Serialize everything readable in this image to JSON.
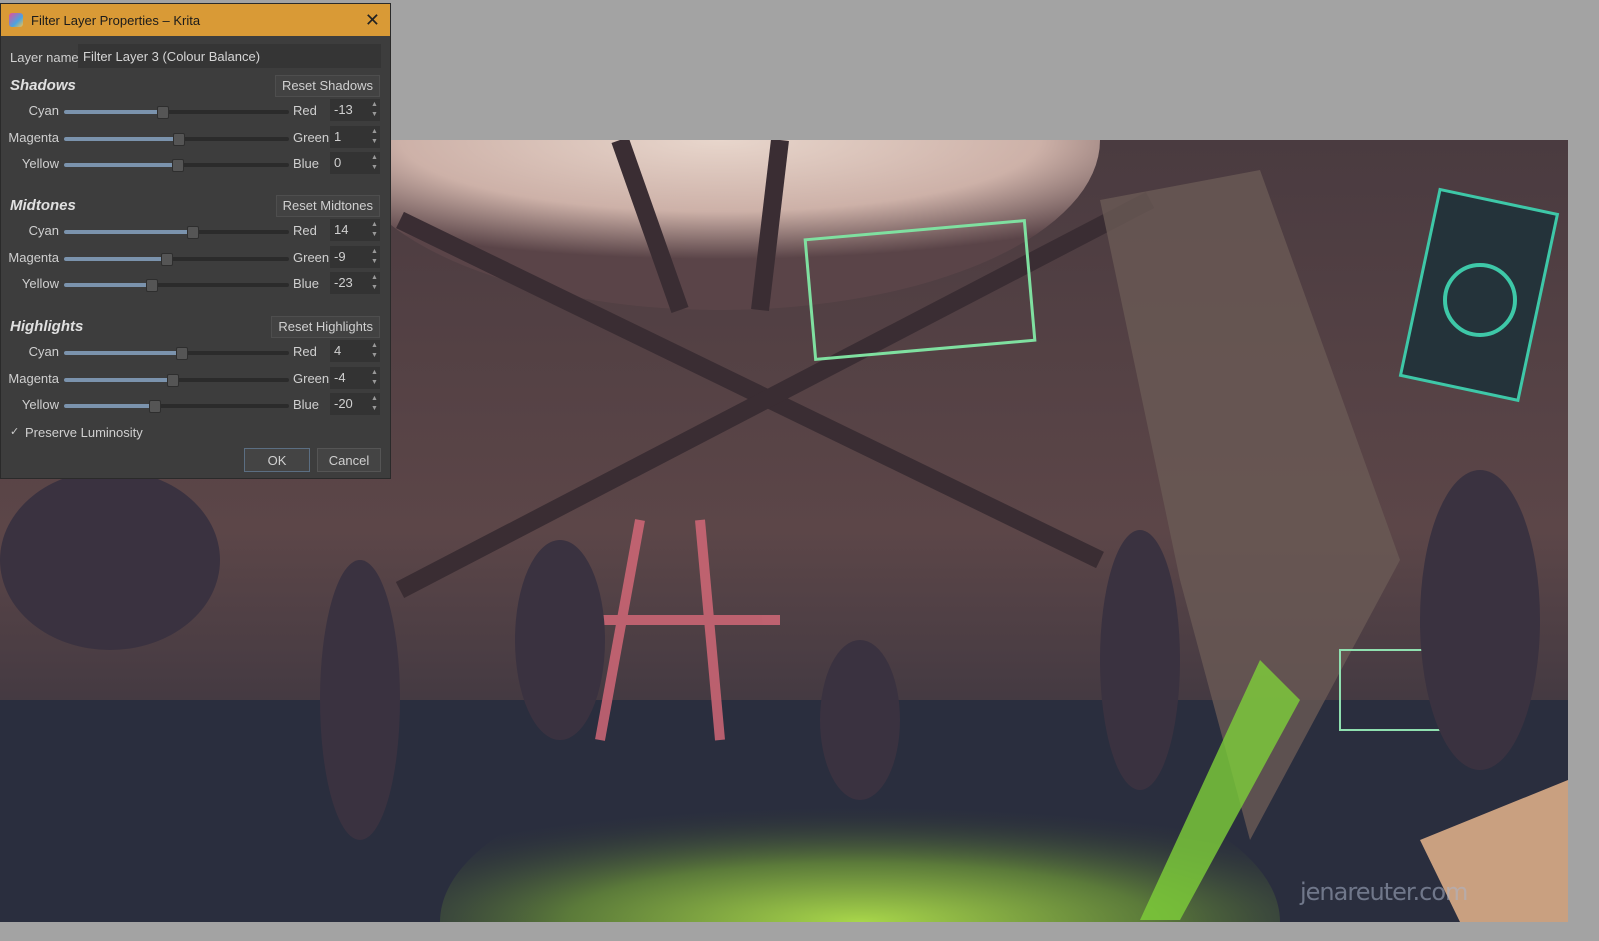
{
  "window": {
    "title": "Filter Layer Properties – Krita",
    "close_icon": "close-icon"
  },
  "layer_name": {
    "label": "Layer name:",
    "value": "Filter Layer 3 (Colour Balance)"
  },
  "sections": [
    {
      "title": "Shadows",
      "reset_label": "Reset Shadows",
      "rows": [
        {
          "left": "Cyan",
          "right": "Red",
          "value": -13
        },
        {
          "left": "Magenta",
          "right": "Green",
          "value": 1
        },
        {
          "left": "Yellow",
          "right": "Blue",
          "value": 0
        }
      ]
    },
    {
      "title": "Midtones",
      "reset_label": "Reset Midtones",
      "rows": [
        {
          "left": "Cyan",
          "right": "Red",
          "value": 14
        },
        {
          "left": "Magenta",
          "right": "Green",
          "value": -9
        },
        {
          "left": "Yellow",
          "right": "Blue",
          "value": -23
        }
      ]
    },
    {
      "title": "Highlights",
      "reset_label": "Reset Highlights",
      "rows": [
        {
          "left": "Cyan",
          "right": "Red",
          "value": 4
        },
        {
          "left": "Magenta",
          "right": "Green",
          "value": -4
        },
        {
          "left": "Yellow",
          "right": "Blue",
          "value": -20
        }
      ]
    }
  ],
  "slider_range": [
    -100,
    100
  ],
  "preserve_luminosity": {
    "label": "Preserve Luminosity",
    "checked": true
  },
  "buttons": {
    "ok": "OK",
    "cancel": "Cancel"
  },
  "artwork": {
    "watermark": "jenareuter.com"
  },
  "colors": {
    "titlebar": "#d99a36",
    "dialog_bg": "#3d3d3d",
    "slider_fill": "#7b93ad"
  }
}
